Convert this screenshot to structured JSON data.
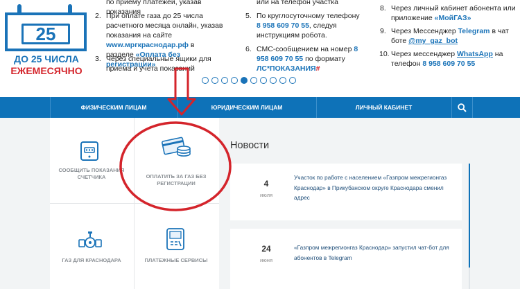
{
  "calendar": {
    "number": "25",
    "line1": "ДО 25 ЧИСЛА",
    "line2": "ЕЖЕМЕСЯЧНО"
  },
  "banner": {
    "col1": [
      {
        "num": "",
        "text": "по приему платежей, указав показания"
      },
      {
        "num": "2.",
        "pre": "При оплате газа до 25 числа расчетного месяца онлайн, указав показания на сайте ",
        "link": "www.мргкраснодар.рф",
        "post": " в разделе ",
        "bold": "«Оплата без регистрации»"
      },
      {
        "num": "3.",
        "text": "Через специальные ящики для приема и учета показаний"
      }
    ],
    "col2": [
      {
        "num": "",
        "text": "или на телефон участка"
      },
      {
        "num": "5.",
        "pre": "По круглосуточному телефону ",
        "phone": "8 958 609 70 55",
        "post": ", следуя инструкциям робота."
      },
      {
        "num": "6.",
        "pre": "СМС-сообщением на номер ",
        "phone": "8 958 609 70 55",
        "post": " по формату ",
        "format": "ЛС*ПОКАЗАНИЯ",
        "hash": "#"
      }
    ],
    "col3": [
      {
        "num": "8.",
        "pre": "Через личный кабинет абонента или приложение ",
        "bold": "«МойГАЗ»"
      },
      {
        "num": "9.",
        "pre": "Через Мессенджер ",
        "bold": "Telegram",
        "post": " в чат боте ",
        "link": "@my_gaz_bot"
      },
      {
        "num": "10.",
        "pre": "Через мессенджер ",
        "link": "WhatsApp",
        "post": " на телефон ",
        "phone": "8 958 609 70 55"
      }
    ],
    "slider": {
      "count": 10,
      "active": 4
    }
  },
  "nav": {
    "items": [
      "ФИЗИЧЕСКИМ ЛИЦАМ",
      "ЮРИДИЧЕСКИМ ЛИЦАМ",
      "ЛИЧНЫЙ КАБИНЕТ"
    ],
    "search_icon": "search-icon"
  },
  "services": [
    {
      "label": "СООБЩИТЬ ПОКАЗАНИЯ СЧЕТЧИКА",
      "icon": "meter-icon"
    },
    {
      "label": "ОПЛАТИТЬ ЗА ГАЗ БЕЗ РЕГИСТРАЦИИ",
      "icon": "card-coins-icon"
    },
    {
      "label": "ГАЗ ДЛЯ КРАСНОДАРА",
      "icon": "pipe-valve-icon"
    },
    {
      "label": "ПЛАТЕЖНЫЕ СЕРВИСЫ",
      "icon": "payment-terminal-icon"
    }
  ],
  "news": {
    "title": "Новости",
    "items": [
      {
        "day": "4",
        "month": "июля",
        "text": "Участок по работе с населением «Газпром межрегионгаз Краснодар» в Прикубанском округе Краснодара сменил адрес"
      },
      {
        "day": "24",
        "month": "июня",
        "text": "«Газпром межрегионгаз Краснодар» запустил чат-бот для абонентов в Telegram"
      }
    ]
  },
  "colors": {
    "brand_blue": "#0e72b8",
    "accent_red": "#d4242b",
    "background": "#f2f4f5"
  }
}
